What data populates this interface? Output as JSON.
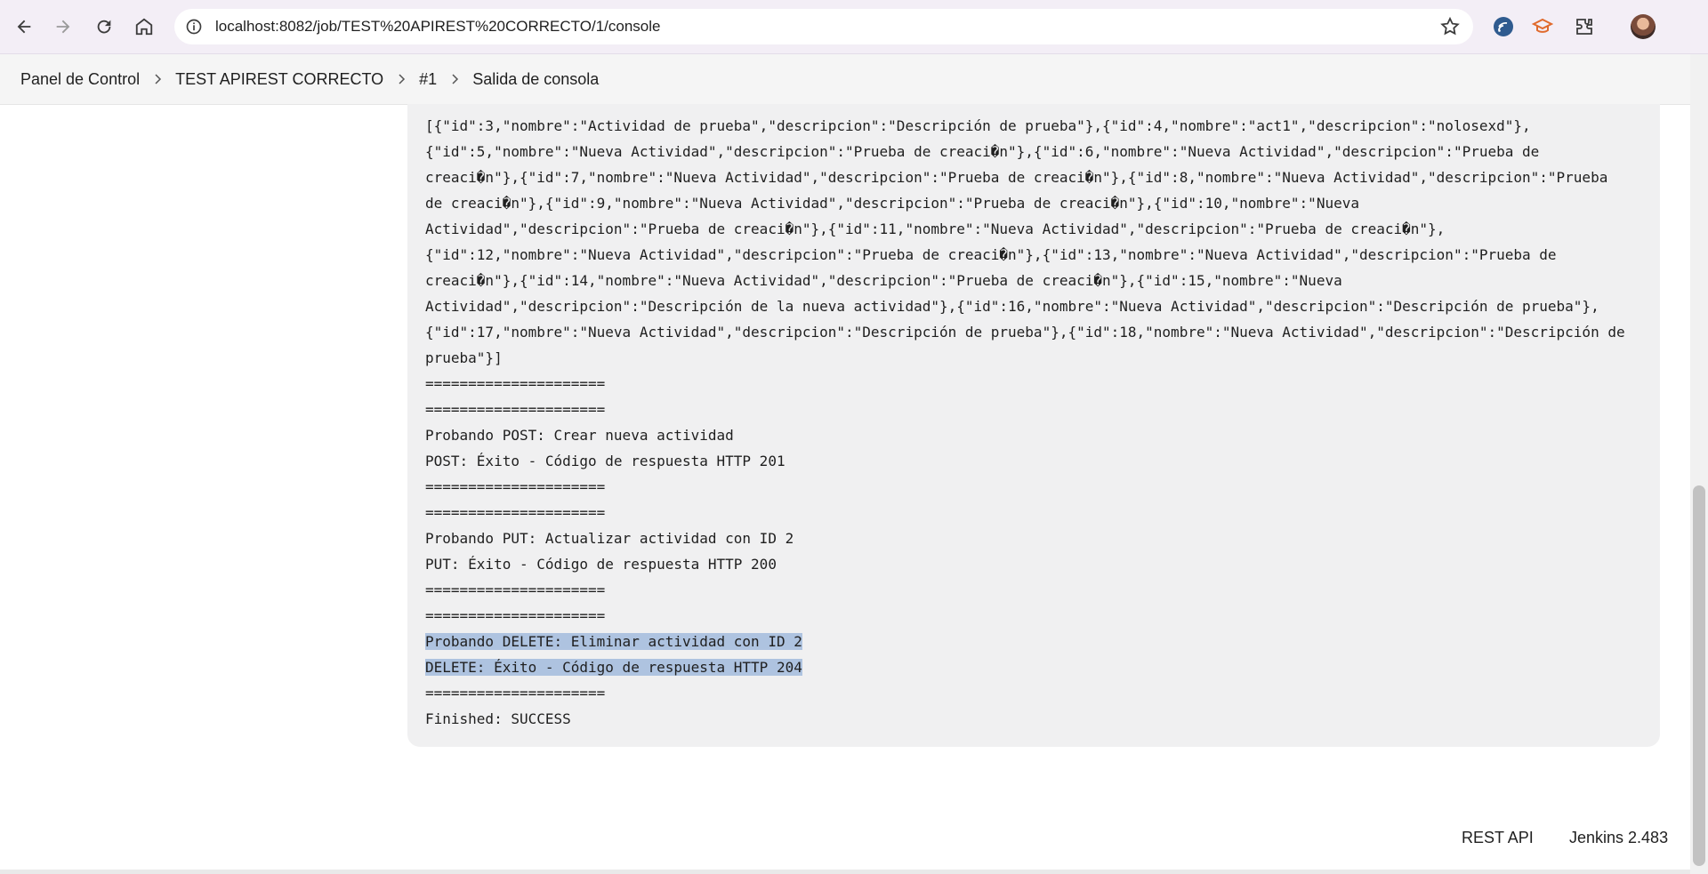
{
  "browser": {
    "url": "localhost:8082/job/TEST%20APIREST%20CORRECTO/1/console"
  },
  "breadcrumb": [
    "Panel de Control",
    "TEST APIREST CORRECTO",
    "#1",
    "Salida de consola"
  ],
  "console": {
    "lines": [
      "[{\"id\":3,\"nombre\":\"Actividad de prueba\",\"descripcion\":\"Descripción de prueba\"},{\"id\":4,\"nombre\":\"act1\",\"descripcion\":\"nolosexd\"},",
      "{\"id\":5,\"nombre\":\"Nueva Actividad\",\"descripcion\":\"Prueba de creaci�n\"},{\"id\":6,\"nombre\":\"Nueva Actividad\",\"descripcion\":\"Prueba de",
      "creaci�n\"},{\"id\":7,\"nombre\":\"Nueva Actividad\",\"descripcion\":\"Prueba de creaci�n\"},{\"id\":8,\"nombre\":\"Nueva Actividad\",\"descripcion\":\"Prueba",
      "de creaci�n\"},{\"id\":9,\"nombre\":\"Nueva Actividad\",\"descripcion\":\"Prueba de creaci�n\"},{\"id\":10,\"nombre\":\"Nueva",
      "Actividad\",\"descripcion\":\"Prueba de creaci�n\"},{\"id\":11,\"nombre\":\"Nueva Actividad\",\"descripcion\":\"Prueba de creaci�n\"},",
      "{\"id\":12,\"nombre\":\"Nueva Actividad\",\"descripcion\":\"Prueba de creaci�n\"},{\"id\":13,\"nombre\":\"Nueva Actividad\",\"descripcion\":\"Prueba de",
      "creaci�n\"},{\"id\":14,\"nombre\":\"Nueva Actividad\",\"descripcion\":\"Prueba de creaci�n\"},{\"id\":15,\"nombre\":\"Nueva",
      "Actividad\",\"descripcion\":\"Descripción de la nueva actividad\"},{\"id\":16,\"nombre\":\"Nueva Actividad\",\"descripcion\":\"Descripción de prueba\"},",
      "{\"id\":17,\"nombre\":\"Nueva Actividad\",\"descripcion\":\"Descripción de prueba\"},{\"id\":18,\"nombre\":\"Nueva Actividad\",\"descripcion\":\"Descripción de",
      "prueba\"}]",
      "=====================",
      "=====================",
      "Probando POST: Crear nueva actividad",
      "POST: Éxito - Código de respuesta HTTP 201",
      "=====================",
      "=====================",
      "Probando PUT: Actualizar actividad con ID 2",
      "PUT: Éxito - Código de respuesta HTTP 200",
      "=====================",
      "=====================",
      "Probando DELETE: Eliminar actividad con ID 2",
      "DELETE: Éxito - Código de respuesta HTTP 204",
      "=====================",
      "Finished: SUCCESS"
    ],
    "highlighted_lines": [
      20,
      21
    ]
  },
  "footer": {
    "rest_api": "REST API",
    "version": "Jenkins 2.483"
  }
}
